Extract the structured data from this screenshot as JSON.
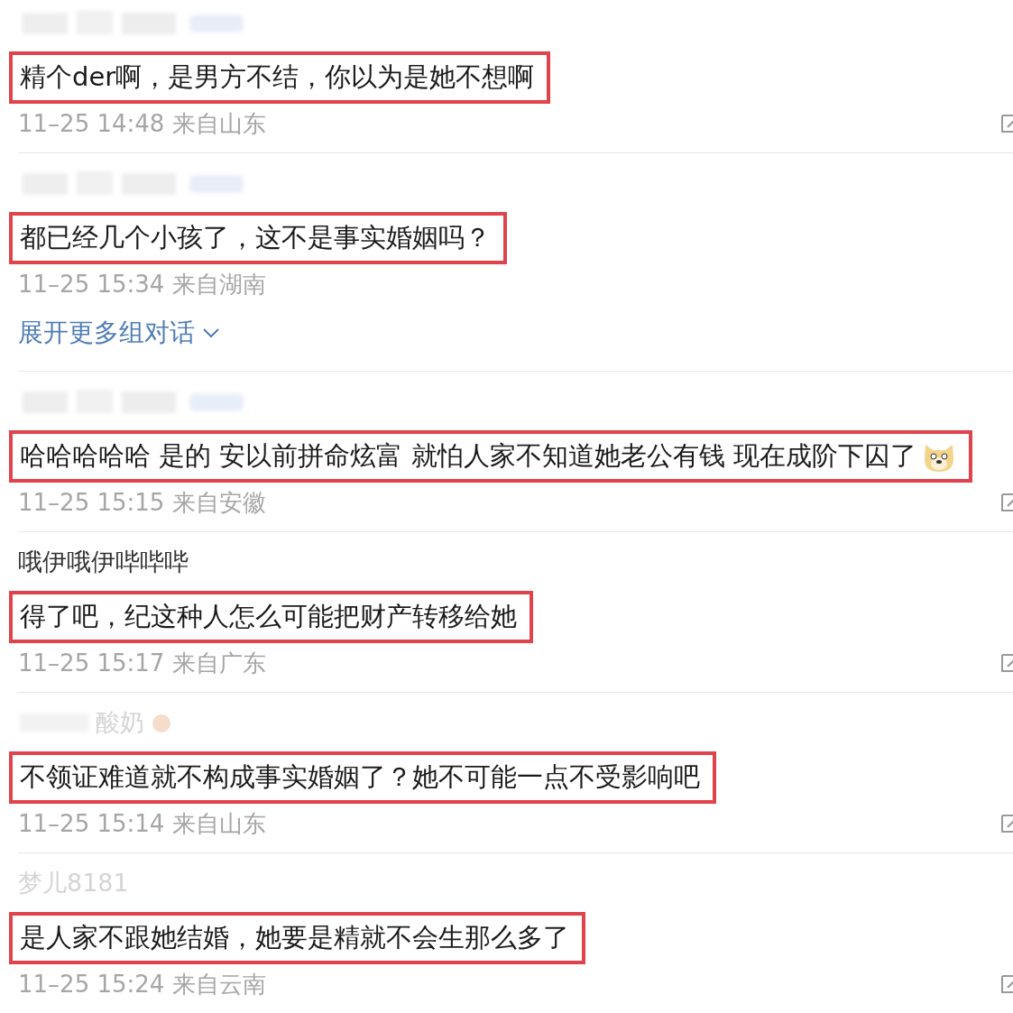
{
  "comments": [
    {
      "username": {
        "kind": "blurred"
      },
      "text": "精个der啊，是男方不结，你以为是她不想啊",
      "emoji": false,
      "time": "11–25 14:48",
      "location": "来自山东",
      "edit": true
    },
    {
      "username": {
        "kind": "blurred"
      },
      "text": "都已经几个小孩了，这不是事实婚姻吗？",
      "emoji": false,
      "time": "11–25 15:34",
      "location": "来自湖南",
      "edit": false,
      "expand_link": "展开更多组对话"
    },
    {
      "username": {
        "kind": "blurred"
      },
      "text": "哈哈哈哈哈 是的 安以前拼命炫富 就怕人家不知道她老公有钱 现在成阶下囚了",
      "emoji": true,
      "time": "11–25 15:15",
      "location": "来自安徽",
      "edit": true
    },
    {
      "username": {
        "kind": "text",
        "text": "哦伊哦伊哔哔哔",
        "faded": false
      },
      "text": "得了吧，纪这种人怎么可能把财产转移给她",
      "emoji": false,
      "time": "11–25 15:17",
      "location": "来自广东",
      "edit": true
    },
    {
      "username": {
        "kind": "partial",
        "text": "酸奶",
        "faded": true
      },
      "text": "不领证难道就不构成事实婚姻了？她不可能一点不受影响吧",
      "emoji": false,
      "time": "11–25 15:14",
      "location": "来自山东",
      "edit": true
    },
    {
      "username": {
        "kind": "text",
        "text": "梦儿8181",
        "faded": true
      },
      "text": "是人家不跟她结婚，她要是精就不会生那么多了",
      "emoji": false,
      "time": "11–25 15:24",
      "location": "来自云南",
      "edit": true
    }
  ]
}
